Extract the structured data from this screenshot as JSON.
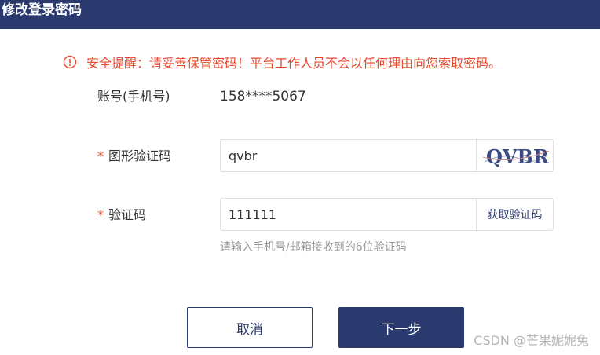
{
  "header": {
    "title": "修改登录密码"
  },
  "warning": {
    "text": "安全提醒：请妥善保管密码！平台工作人员不会以任何理由向您索取密码。",
    "color": "#e64a2e"
  },
  "account": {
    "label": "账号(手机号)",
    "value": "158****5067"
  },
  "captcha": {
    "required_mark": "*",
    "label": "图形验证码",
    "value": "qvbr",
    "image_text": "QVBR"
  },
  "sms": {
    "required_mark": "*",
    "label": "验证码",
    "value": "111111",
    "get_code_label": "获取验证码",
    "hint": "请输入手机号/邮箱接收到的6位验证码"
  },
  "actions": {
    "cancel_label": "取消",
    "next_label": "下一步"
  },
  "watermark": "CSDN @芒果妮妮兔",
  "colors": {
    "primary": "#2b3a6e",
    "danger": "#e64a2e"
  }
}
